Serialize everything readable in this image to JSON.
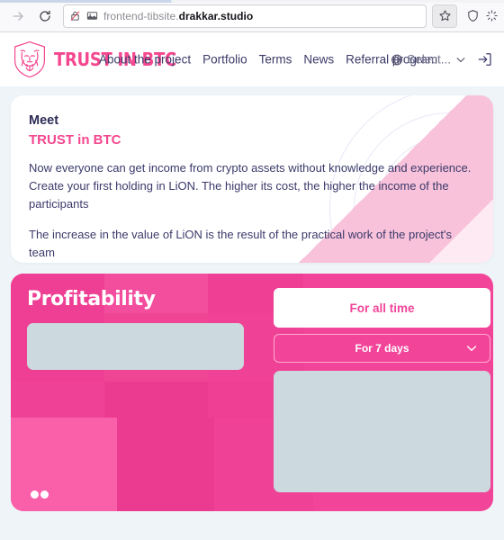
{
  "browser": {
    "forward_icon": "forward-arrow-icon",
    "reload_icon": "reload-icon",
    "security_icon": "lock-crossed-out-icon",
    "page_icon": "page-image-icon",
    "url_prefix": "frontend-tibsite.",
    "url_domain": "drakkar.studio",
    "url_full": "frontend-tibsite.drakkar.studio",
    "bookmark_icon": "star-icon",
    "shield_icon": "shield-icon",
    "extension_icon": "extension-icon"
  },
  "header": {
    "logo_icon": "lion-shield-logo-icon",
    "brand_name": "TRUST IN BTC",
    "nav": [
      {
        "label": "About the project"
      },
      {
        "label": "Portfolio"
      },
      {
        "label": "Terms"
      },
      {
        "label": "News"
      },
      {
        "label": "Referral program"
      }
    ],
    "language": {
      "icon": "globe-icon",
      "label": "Select...",
      "chevron_icon": "chevron-down-icon"
    },
    "login_icon": "login-icon"
  },
  "hero": {
    "eyebrow": "Meet",
    "title": "TRUST in BTC",
    "paragraphs": [
      "Now everyone can get income from crypto assets without knowledge and experience. Create your first holding in LiON. The higher its cost, the higher the income of the participants",
      "The increase in the value of LiON is the result of the practical work of the project's team"
    ]
  },
  "profitability": {
    "heading": "Profitability",
    "chart_placeholder": "",
    "all_time_label": "For all time",
    "period_label": "For 7 days",
    "period_chevron_icon": "chevron-down-icon",
    "stats_placeholder": "",
    "carousel_dots": 2
  },
  "colors": {
    "brand_pink": "#f4478f",
    "card_pink": "#f2459a",
    "text_navy": "#3b3a6b",
    "page_bg": "#eef4f7",
    "skeleton": "#ccd9de"
  }
}
